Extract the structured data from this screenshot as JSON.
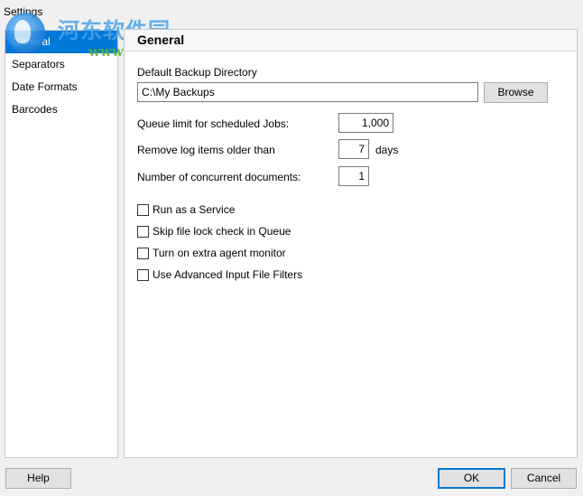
{
  "window": {
    "title": "Settings"
  },
  "watermark": {
    "text": "河东软件园",
    "url": "www.pc0359.cn"
  },
  "sidebar": {
    "items": [
      {
        "label": "General",
        "selected": true
      },
      {
        "label": "Separators",
        "selected": false
      },
      {
        "label": "Date Formats",
        "selected": false
      },
      {
        "label": "Barcodes",
        "selected": false
      }
    ]
  },
  "panel": {
    "title": "General",
    "backup_dir_label": "Default Backup Directory",
    "backup_dir_value": "C:\\My Backups",
    "browse_label": "Browse",
    "queue_limit_label": "Queue limit for scheduled Jobs:",
    "queue_limit_value": "1,000",
    "remove_log_label": "Remove log items older than",
    "remove_log_value": "7",
    "remove_log_unit": "days",
    "concurrent_label": "Number of concurrent documents:",
    "concurrent_value": "1",
    "checkboxes": [
      {
        "label": "Run as a Service",
        "checked": false
      },
      {
        "label": "Skip file lock check in Queue",
        "checked": false
      },
      {
        "label": "Turn on extra agent monitor",
        "checked": false
      },
      {
        "label": "Use Advanced Input File Filters",
        "checked": false
      }
    ]
  },
  "footer": {
    "help_label": "Help",
    "ok_label": "OK",
    "cancel_label": "Cancel"
  },
  "colors": {
    "accent": "#0078d7",
    "window_bg": "#f0f0f0"
  }
}
